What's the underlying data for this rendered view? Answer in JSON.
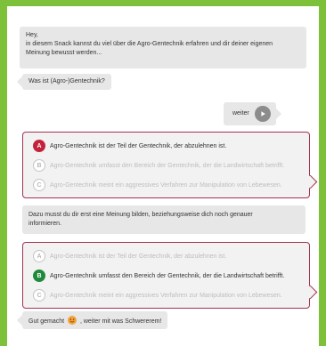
{
  "colors": {
    "background": "#7dc13a",
    "panel": "#ffffff",
    "bubble": "#e7e7e7",
    "quiz_border": "#a3324f",
    "wrong_badge": "#c4213b",
    "right_badge": "#1f8a3b"
  },
  "chat": {
    "intro_line1": "Hey,",
    "intro_line2": "in diesem Snack kannst du viel über die Agro-Gentechnik erfahren und dir deiner eigenen",
    "intro_line3": "Meinung bewusst werden...",
    "question": "Was ist (Agro-)Gentechnik?",
    "next_label": "weiter",
    "follow_up_line1": "Dazu musst du dir erst eine Meinung bilden, beziehungsweise dich noch genauer",
    "follow_up_line2": "informieren.",
    "final_before": "Gut gemacht",
    "final_after": ", weiter mit was Schwererem!"
  },
  "quiz1": {
    "options": [
      {
        "letter": "A",
        "text": "Agro-Gentechnik ist der Teil der Gentechnik, der abzulehnen ist.",
        "state": "selected-wrong"
      },
      {
        "letter": "B",
        "text": "Agro-Gentechnik umfasst den Bereich der Gentechnik, der die Landwirtschaft betrifft.",
        "state": "inactive"
      },
      {
        "letter": "C",
        "text": "Agro-Gentechnik meint ein aggressives Verfahren zur Manipulation von Lebewesen.",
        "state": "inactive"
      }
    ]
  },
  "quiz2": {
    "options": [
      {
        "letter": "A",
        "text": "Agro-Gentechnik ist der Teil der Gentechnik, der abzulehnen ist.",
        "state": "inactive"
      },
      {
        "letter": "B",
        "text": "Agro-Gentechnik umfasst den Bereich der Gentechnik, der die Landwirtschaft betrifft.",
        "state": "selected-correct"
      },
      {
        "letter": "C",
        "text": "Agro-Gentechnik meint ein aggressives Verfahren zur Manipulation von Lebewesen.",
        "state": "inactive"
      }
    ]
  },
  "icons": {
    "next": "play-icon",
    "emoji": "smiley-icon"
  }
}
